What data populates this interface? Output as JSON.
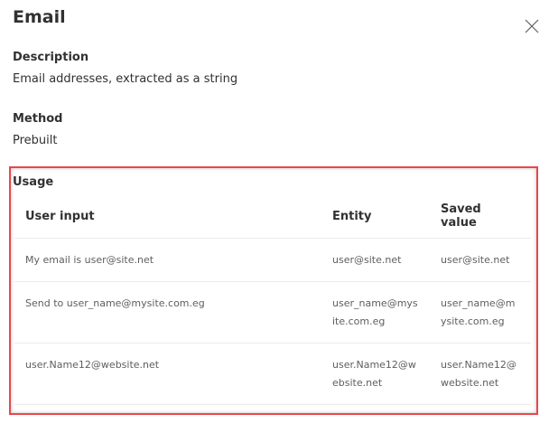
{
  "title": "Email",
  "description": {
    "label": "Description",
    "value": "Email addresses, extracted as a string"
  },
  "method": {
    "label": "Method",
    "value": "Prebuilt"
  },
  "usage": {
    "label": "Usage",
    "columns": [
      "User input",
      "Entity",
      "Saved value"
    ],
    "rows": [
      [
        "My email is user@site.net",
        "user@site.net",
        "user@site.net"
      ],
      [
        "Send to user_name@mysite.com.eg",
        "user_name@mysite.com.eg",
        "user_name@mysite.com.eg"
      ],
      [
        "user.Name12@website.net",
        "user.Name12@website.net",
        "user.Name12@website.net"
      ]
    ]
  },
  "colors": {
    "highlight": "#e8474c"
  }
}
